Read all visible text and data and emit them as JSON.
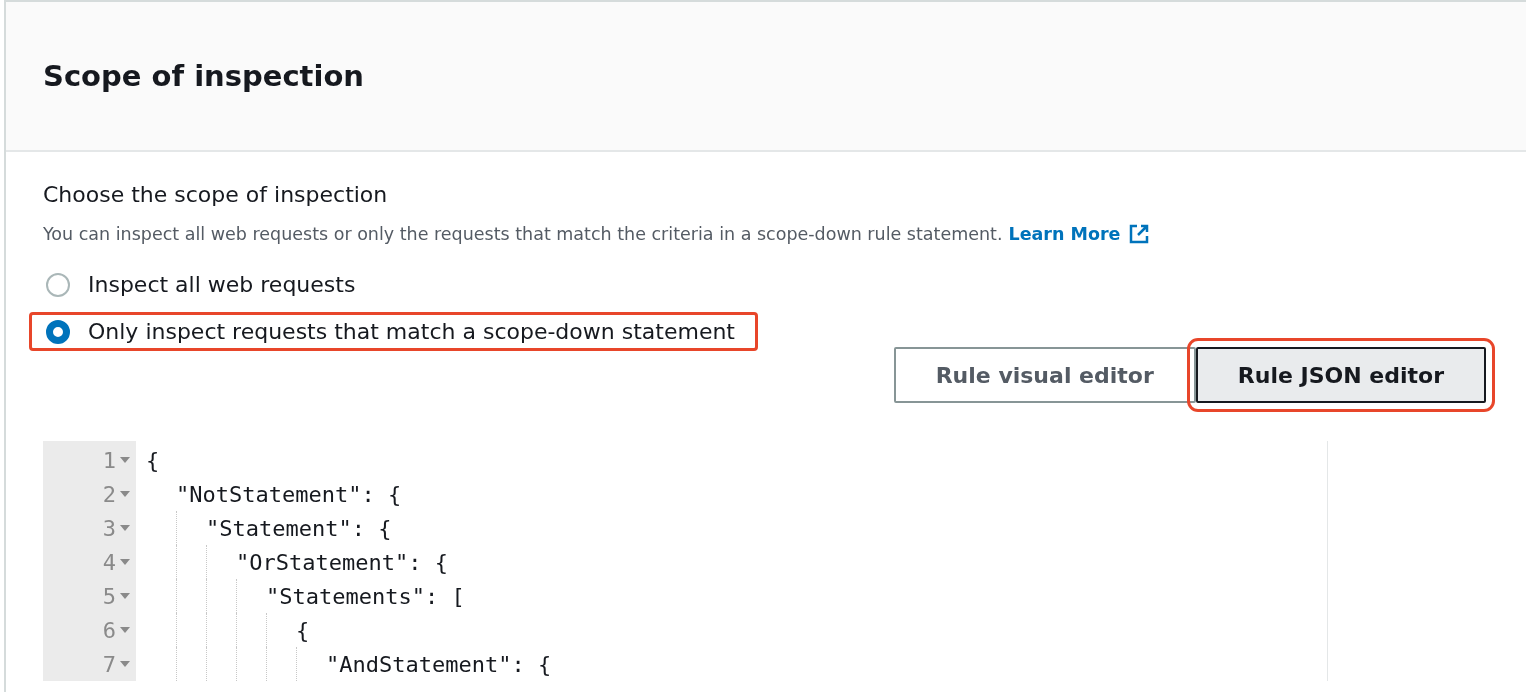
{
  "header": {
    "title": "Scope of inspection"
  },
  "field": {
    "label": "Choose the scope of inspection",
    "description": "You can inspect all web requests or only the requests that match the criteria in a scope-down rule statement.",
    "link": "Learn More"
  },
  "options": [
    {
      "label": "Inspect all web requests",
      "selected": false,
      "highlighted": false
    },
    {
      "label": "Only inspect requests that match a scope-down statement",
      "selected": true,
      "highlighted": true
    }
  ],
  "editor_tabs": [
    {
      "label": "Rule visual editor",
      "selected": false,
      "highlighted": false
    },
    {
      "label": "Rule JSON editor",
      "selected": true,
      "highlighted": true
    }
  ],
  "code": [
    {
      "number": "1",
      "text": "{",
      "children": [
        {
          "number": "2",
          "text": "\"NotStatement\": {",
          "children": [
            {
              "number": "3",
              "text": "\"Statement\": {",
              "children": [
                {
                  "number": "4",
                  "text": "\"OrStatement\": {",
                  "children": [
                    {
                      "number": "5",
                      "text": "\"Statements\": [",
                      "children": [
                        {
                          "number": "6",
                          "text": "{",
                          "children": [
                            {
                              "number": "7",
                              "text": "\"AndStatement\": {"
                            }
                          ]
                        }
                      ]
                    }
                  ]
                }
              ]
            }
          ]
        }
      ]
    }
  ]
}
